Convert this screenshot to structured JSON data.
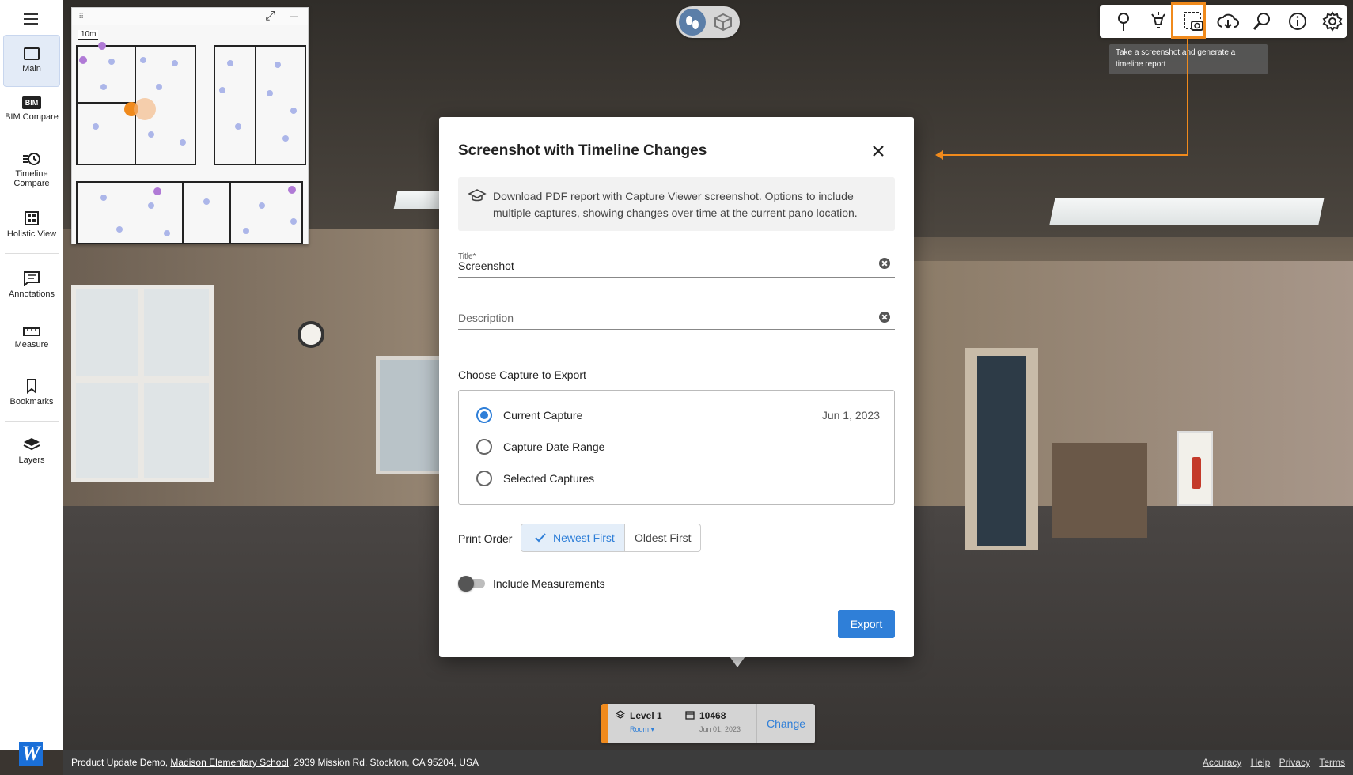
{
  "sidebar": {
    "items": [
      {
        "label": "Main",
        "icon": "main-view-icon"
      },
      {
        "label": "BIM Compare",
        "icon": "bim-icon",
        "icon_text": "BIM"
      },
      {
        "label": "Timeline Compare",
        "icon": "timeline-icon"
      },
      {
        "label": "Holistic View",
        "icon": "grid-icon"
      },
      {
        "label": "Annotations",
        "icon": "annotation-icon"
      },
      {
        "label": "Measure",
        "icon": "ruler-icon"
      },
      {
        "label": "Bookmarks",
        "icon": "bookmark-icon"
      },
      {
        "label": "Layers",
        "icon": "layers-icon"
      }
    ],
    "logo": "W"
  },
  "minimap": {
    "scale": "10m"
  },
  "toolbar": {
    "tooltip": "Take a screenshot and generate a timeline report",
    "buttons": [
      "location-pin-icon",
      "light-icon",
      "screenshot-camera-icon",
      "cloud-download-icon",
      "zoom-search-icon",
      "info-icon",
      "settings-icon"
    ]
  },
  "modal": {
    "title": "Screenshot with Timeline Changes",
    "info": "Download PDF report with Capture Viewer screenshot. Options to include multiple captures, showing changes over time at the current pano location.",
    "title_field_label": "Title*",
    "title_value": "Screenshot",
    "description_placeholder": "Description",
    "capture_section_label": "Choose Capture to Export",
    "capture_options": [
      {
        "label": "Current Capture",
        "date": "Jun 1, 2023",
        "selected": true
      },
      {
        "label": "Capture Date Range",
        "date": "",
        "selected": false
      },
      {
        "label": "Selected Captures",
        "date": "",
        "selected": false
      }
    ],
    "print_order_label": "Print Order",
    "print_order_options": [
      "Newest First",
      "Oldest First"
    ],
    "print_order_selected": "Newest First",
    "include_measurements_label": "Include Measurements",
    "include_measurements": false,
    "export_label": "Export"
  },
  "level_selector": {
    "level": "Level 1",
    "zone": "Room",
    "capture_id": "10468",
    "capture_date": "Jun 01, 2023",
    "change_label": "Change"
  },
  "footer": {
    "project": "Product Update Demo,",
    "site": "Madison Elementary School",
    "address": ", 2939 Mission Rd, Stockton, CA 95204, USA",
    "links": [
      "Accuracy",
      "Help",
      "Privacy",
      "Terms"
    ]
  },
  "colors": {
    "accent": "#2f7fd8",
    "highlight": "#f08a1c"
  }
}
